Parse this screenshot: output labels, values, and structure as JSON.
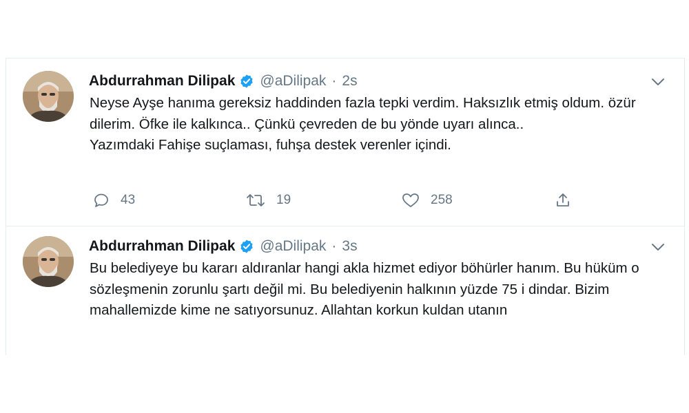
{
  "tweets": [
    {
      "name": "Abdurrahman Dilipak",
      "handle": "@aDilipak",
      "separator": "·",
      "time": "2s",
      "lines": [
        "Neyse Ayşe hanıma gereksiz haddinden fazla tepki verdim. Haksızlık etmiş oldum. özür dilerim. Öfke ile kalkınca.. Çünkü çevreden de bu yönde uyarı alınca..",
        "Yazımdaki Fahişe suçlaması, fuhşa destek verenler içindi."
      ],
      "replies": "43",
      "retweets": "19",
      "likes": "258",
      "icons": [
        "verified-badge-icon",
        "chevron-down-icon",
        "reply-icon",
        "retweet-icon",
        "heart-icon",
        "share-icon"
      ]
    },
    {
      "name": "Abdurrahman Dilipak",
      "handle": "@aDilipak",
      "separator": "·",
      "time": "3s",
      "lines": [
        "Bu belediyeye bu kararı aldıranlar hangi akla hizmet ediyor böhürler hanım. Bu hüküm o sözleşmenin zorunlu şartı değil mi. Bu belediyenin halkının yüzde 75 i dindar. Bizim mahallemizde kime ne satıyorsunuz. Allahtan korkun kuldan utanın"
      ],
      "icons": [
        "verified-badge-icon",
        "chevron-down-icon"
      ]
    }
  ],
  "colors": {
    "text": "#14171a",
    "secondary": "#657786",
    "verified": "#1da1f2",
    "border": "#e6ecf0"
  }
}
